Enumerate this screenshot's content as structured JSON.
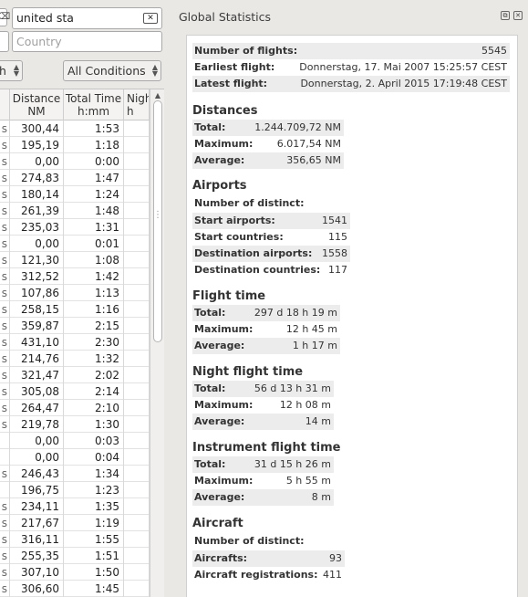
{
  "filters": {
    "search_value": "united sta",
    "country_placeholder": "Country",
    "combo_left_value": "h",
    "conditions_value": "All Conditions"
  },
  "table": {
    "headers": [
      "Distance\nNM",
      "Total Time\nh:mm",
      "Nigh\nh"
    ],
    "rows": [
      [
        "s",
        "300,44",
        "1:53"
      ],
      [
        "s",
        "195,19",
        "1:18"
      ],
      [
        "s",
        "0,00",
        "0:00"
      ],
      [
        "s",
        "274,83",
        "1:47"
      ],
      [
        "s",
        "180,14",
        "1:24"
      ],
      [
        "s",
        "261,39",
        "1:48"
      ],
      [
        "s",
        "235,03",
        "1:31"
      ],
      [
        "s",
        "0,00",
        "0:01"
      ],
      [
        "s",
        "121,30",
        "1:08"
      ],
      [
        "s",
        "312,52",
        "1:42"
      ],
      [
        "s",
        "107,86",
        "1:13"
      ],
      [
        "s",
        "258,15",
        "1:16"
      ],
      [
        "s",
        "359,87",
        "2:15"
      ],
      [
        "s",
        "431,10",
        "2:30"
      ],
      [
        "s",
        "214,76",
        "1:32"
      ],
      [
        "s",
        "321,47",
        "2:02"
      ],
      [
        "s",
        "305,08",
        "2:14"
      ],
      [
        "s",
        "264,47",
        "2:10"
      ],
      [
        "s",
        "219,78",
        "1:30"
      ],
      [
        "",
        "0,00",
        "0:03"
      ],
      [
        "",
        "0,00",
        "0:04"
      ],
      [
        "s",
        "246,43",
        "1:34"
      ],
      [
        "",
        "196,75",
        "1:23"
      ],
      [
        "s",
        "234,11",
        "1:35"
      ],
      [
        "s",
        "217,67",
        "1:19"
      ],
      [
        "s",
        "316,11",
        "1:55"
      ],
      [
        "s",
        "255,35",
        "1:51"
      ],
      [
        "s",
        "307,10",
        "1:50"
      ],
      [
        "s",
        "306,60",
        "1:45"
      ]
    ]
  },
  "panel": {
    "title": "Global Statistics",
    "general": [
      {
        "k": "Number of flights:",
        "v": "5545"
      },
      {
        "k": "Earliest flight:",
        "v": "Donnerstag, 17. Mai 2007 15:25:57 CEST"
      },
      {
        "k": "Latest flight:",
        "v": "Donnerstag, 2. April 2015 17:19:48 CEST"
      }
    ],
    "distances": {
      "title": "Distances",
      "rows": [
        {
          "k": "Total:",
          "v": "1.244.709,72 NM"
        },
        {
          "k": "Maximum:",
          "v": "6.017,54 NM"
        },
        {
          "k": "Average:",
          "v": "356,65 NM"
        }
      ]
    },
    "airports": {
      "title": "Airports",
      "subtitle": "Number of distinct:",
      "rows": [
        {
          "k": "Start airports:",
          "v": "1541"
        },
        {
          "k": "Start countries:",
          "v": "115"
        },
        {
          "k": "Destination airports:",
          "v": "1558"
        },
        {
          "k": "Destination countries:",
          "v": "117"
        }
      ]
    },
    "flight_time": {
      "title": "Flight time",
      "rows": [
        {
          "k": "Total:",
          "v": "297 d 18 h 19 m"
        },
        {
          "k": "Maximum:",
          "v": "12 h 45 m"
        },
        {
          "k": "Average:",
          "v": "1 h 17 m"
        }
      ]
    },
    "night_time": {
      "title": "Night flight time",
      "rows": [
        {
          "k": "Total:",
          "v": "56 d 13 h 31 m"
        },
        {
          "k": "Maximum:",
          "v": "12 h 08 m"
        },
        {
          "k": "Average:",
          "v": "14 m"
        }
      ]
    },
    "instrument_time": {
      "title": "Instrument flight time",
      "rows": [
        {
          "k": "Total:",
          "v": "31 d 15 h 26 m"
        },
        {
          "k": "Maximum:",
          "v": "5 h 55 m"
        },
        {
          "k": "Average:",
          "v": "8 m"
        }
      ]
    },
    "aircraft": {
      "title": "Aircraft",
      "subtitle": "Number of distinct:",
      "rows": [
        {
          "k": "Aircrafts:",
          "v": "93"
        },
        {
          "k": "Aircraft registrations:",
          "v": "411"
        }
      ]
    }
  }
}
